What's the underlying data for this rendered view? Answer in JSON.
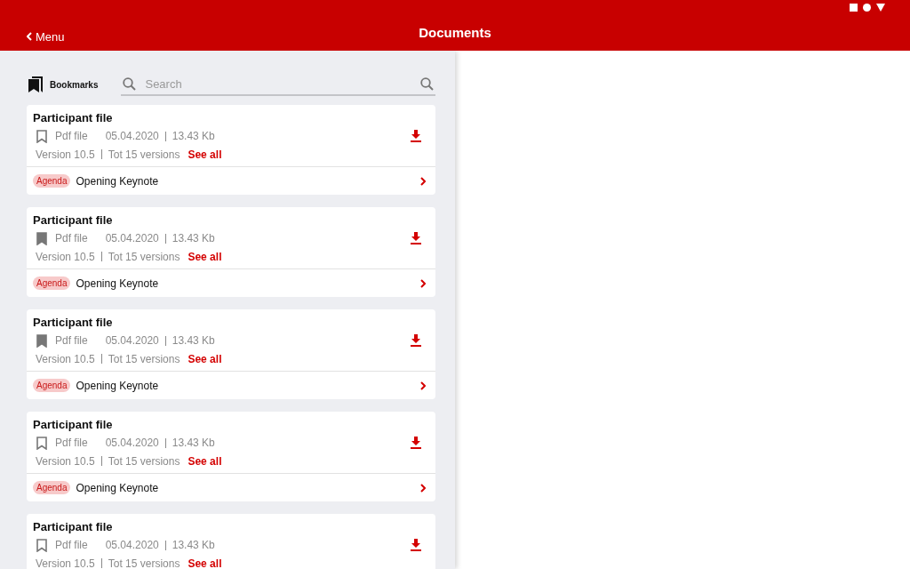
{
  "header": {
    "back": "Menu",
    "title": "Documents"
  },
  "toolbar": {
    "bookmarks": "Bookmarks",
    "search": {
      "placeholder": "Search"
    }
  },
  "documents": [
    {
      "title": "Participant file",
      "bookmarked": false,
      "type": "Pdf file",
      "date": "05.04.2020",
      "size": "13.43 Kb",
      "version": "Version 10.5",
      "total": "Tot 15 versions",
      "link": "See all",
      "tag": "Agenda",
      "session": "Opening Keynote"
    },
    {
      "title": "Participant file",
      "bookmarked": true,
      "type": "Pdf file",
      "date": "05.04.2020",
      "size": "13.43 Kb",
      "version": "Version 10.5",
      "total": "Tot 15 versions",
      "link": "See all",
      "tag": "Agenda",
      "session": "Opening Keynote"
    },
    {
      "title": "Participant file",
      "bookmarked": true,
      "type": "Pdf file",
      "date": "05.04.2020",
      "size": "13.43 Kb",
      "version": "Version 10.5",
      "total": "Tot 15 versions",
      "link": "See all",
      "tag": "Agenda",
      "session": "Opening Keynote"
    },
    {
      "title": "Participant file",
      "bookmarked": false,
      "type": "Pdf file",
      "date": "05.04.2020",
      "size": "13.43 Kb",
      "version": "Version 10.5",
      "total": "Tot 15 versions",
      "link": "See all",
      "tag": "Agenda",
      "session": "Opening Keynote"
    },
    {
      "title": "Participant file",
      "bookmarked": false,
      "type": "Pdf file",
      "date": "05.04.2020",
      "size": "13.43 Kb",
      "version": "Version 10.5",
      "total": "Tot 15 versions",
      "link": "See all"
    }
  ]
}
